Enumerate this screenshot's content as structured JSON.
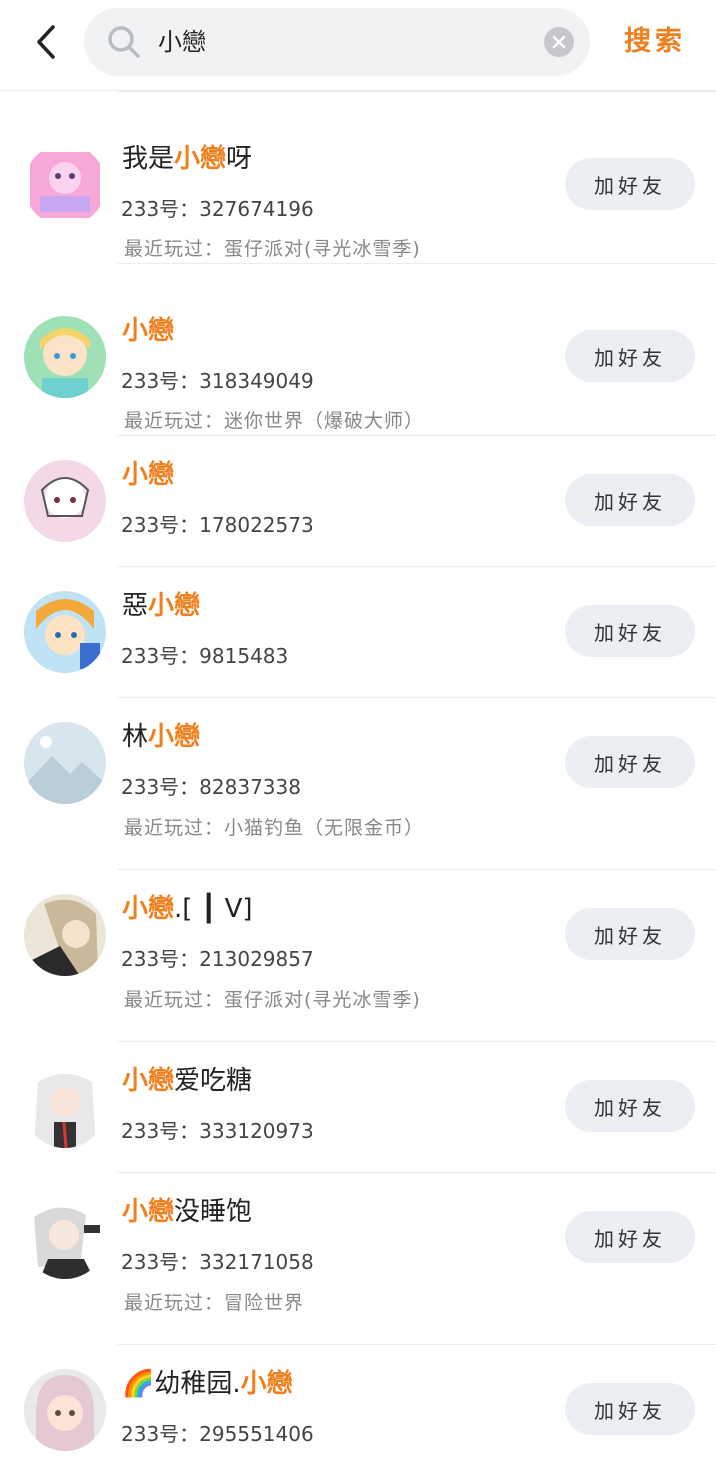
{
  "search": {
    "query": "小戀",
    "button_label": "搜索"
  },
  "results": [
    {
      "prefix": "我是",
      "highlight": "小戀",
      "suffix": "呀",
      "uid": "233号：327674196",
      "recent": "最近玩过：蛋仔派对(寻光冰雪季)",
      "add_label": "加好友",
      "avatar_color": "#f6a9d8"
    },
    {
      "prefix": "",
      "highlight": "小戀",
      "suffix": "",
      "uid": "233号：318349049",
      "recent": "最近玩过：迷你世界（爆破大师）",
      "add_label": "加好友",
      "avatar_color": "#9fe0b6"
    },
    {
      "prefix": "",
      "highlight": "小戀",
      "suffix": "",
      "uid": "233号：178022573",
      "recent": "",
      "add_label": "加好友",
      "avatar_color": "#f3d9e8"
    },
    {
      "prefix": "惡",
      "highlight": "小戀",
      "suffix": "",
      "uid": "233号：9815483",
      "recent": "",
      "add_label": "加好友",
      "avatar_color": "#f3a93a"
    },
    {
      "prefix": "林",
      "highlight": "小戀",
      "suffix": "",
      "uid": "233号：82837338",
      "recent": "最近玩过：小猫钓鱼（无限金币）",
      "add_label": "加好友",
      "avatar_color": "#d7e6ee"
    },
    {
      "prefix": "",
      "highlight": "小戀",
      "suffix": ".[ ┃ V]",
      "uid": "233号：213029857",
      "recent": "最近玩过：蛋仔派对(寻光冰雪季)",
      "add_label": "加好友",
      "avatar_color": "#c9b89a"
    },
    {
      "prefix": "",
      "highlight": "小戀",
      "suffix": "爱吃糖",
      "uid": "233号：333120973",
      "recent": "",
      "add_label": "加好友",
      "avatar_color": "#e8e8ea"
    },
    {
      "prefix": "",
      "highlight": "小戀",
      "suffix": "没睡饱",
      "uid": "233号：332171058",
      "recent": "最近玩过：冒险世界",
      "add_label": "加好友",
      "avatar_color": "#d9d9d9"
    },
    {
      "prefix": "🌈幼稚园.",
      "highlight": "小戀",
      "suffix": "",
      "uid": "233号：295551406",
      "recent": "",
      "add_label": "加好友",
      "avatar_color": "#e4c8d4"
    }
  ],
  "accent_color": "#f0801e"
}
